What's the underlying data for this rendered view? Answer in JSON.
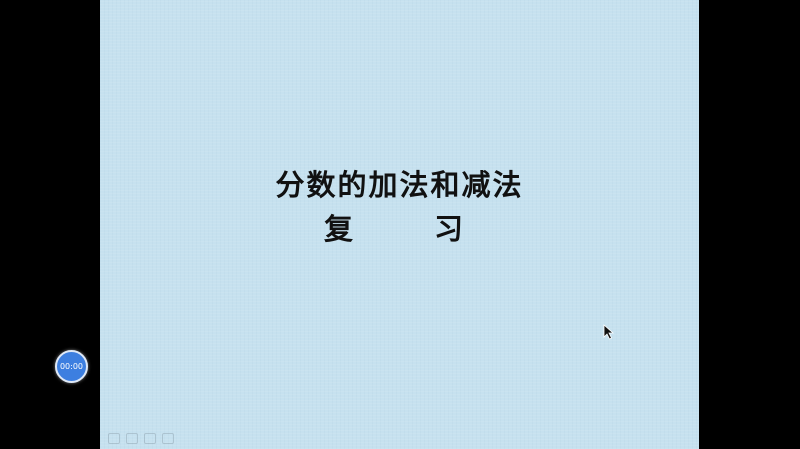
{
  "slide": {
    "title": "分数的加法和减法",
    "subtitle_left": "复",
    "subtitle_right": "习"
  },
  "recorder": {
    "timer": "00:00"
  },
  "icons": {
    "cursor": "mouse-pointer-icon",
    "controls": [
      "prev-slide-icon",
      "next-slide-icon",
      "menu-icon",
      "pen-icon"
    ]
  },
  "colors": {
    "slide_background": "#c6e1ef",
    "timer_background": "#3d7fe0"
  }
}
